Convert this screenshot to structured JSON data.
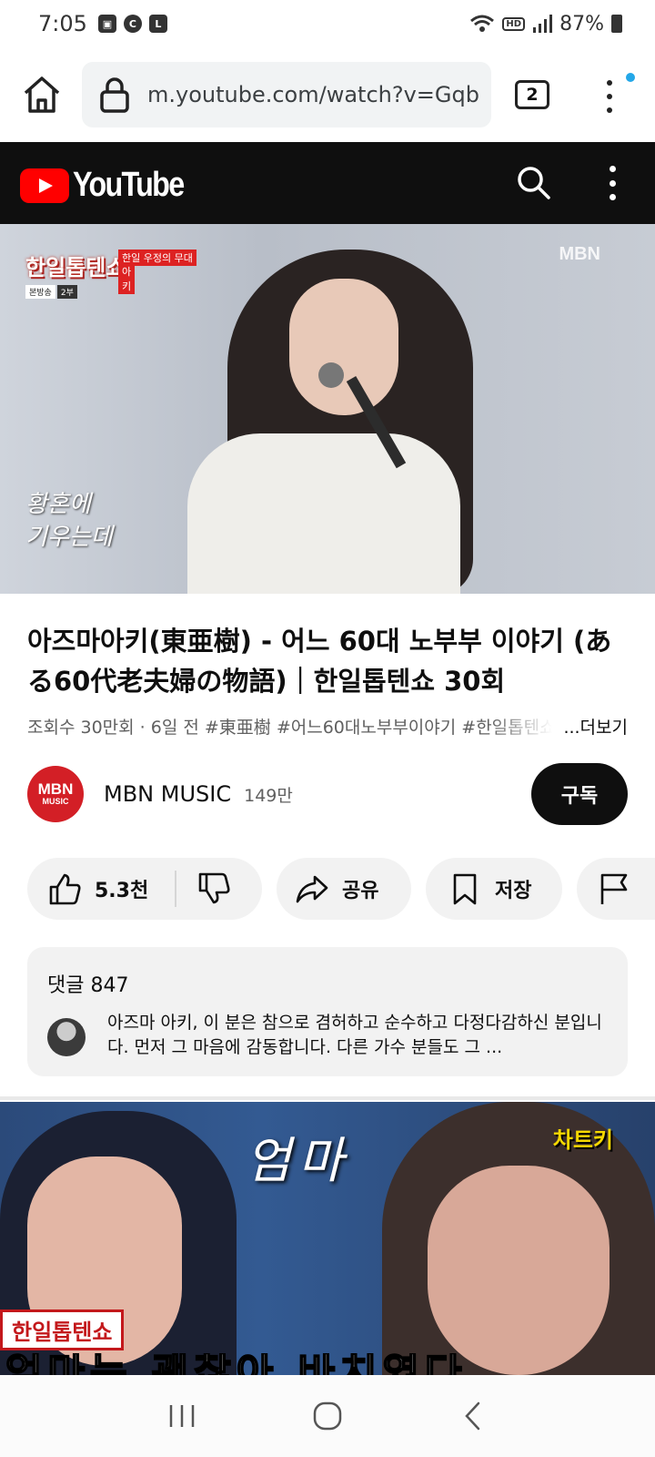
{
  "status_bar": {
    "time": "7:05",
    "notification_icons": [
      "image-icon",
      "c-icon",
      "l-icon"
    ],
    "battery": "87%"
  },
  "browser": {
    "url": "m.youtube.com/watch?v=Gqb",
    "tab_count": "2"
  },
  "youtube_header": {
    "logo_text": "YouTube"
  },
  "player": {
    "show_title": "한일톱텐쇼",
    "show_tag": "한일 우정의 무대",
    "show_tag2": "아키",
    "show_sub_left": "본방송",
    "show_sub_right": "2부",
    "watermark": "MBN",
    "caption_line1": "황혼에",
    "caption_line2": "기우는데"
  },
  "video": {
    "title": "아즈마아키(東亜樹) - 어느 60대 노부부 이야기 (ある60代老夫婦の物語)｜한일톱텐쇼 30회",
    "meta": "조회수 30만회 · 6일 전  #東亜樹 #어느60대노부부이야기 #한일톱텐쇼",
    "more_label": "...더보기"
  },
  "channel": {
    "avatar_top": "MBN",
    "avatar_bottom": "MUSIC",
    "name": "MBN MUSIC",
    "subscribers": "149만",
    "subscribe_label": "구독"
  },
  "actions": {
    "like_count": "5.3천",
    "share_label": "공유",
    "save_label": "저장"
  },
  "comments": {
    "header": "댓글 847",
    "top_comment": "아즈마 아키, 이 분은 참으로 겸허하고 순수하고 다정다감하신 분입니다. 먼저 그 마음에 감동합니다. 다른 가수 분들도 그 ..."
  },
  "next_video": {
    "script_text": "엄마",
    "badge": "한일톱텐쇼",
    "corner_text": "차트키",
    "bottom_text": "엄마는 괜찮아 바치였다"
  },
  "nav": {
    "buttons": [
      "recents-icon",
      "home-circle-icon",
      "back-icon"
    ]
  }
}
